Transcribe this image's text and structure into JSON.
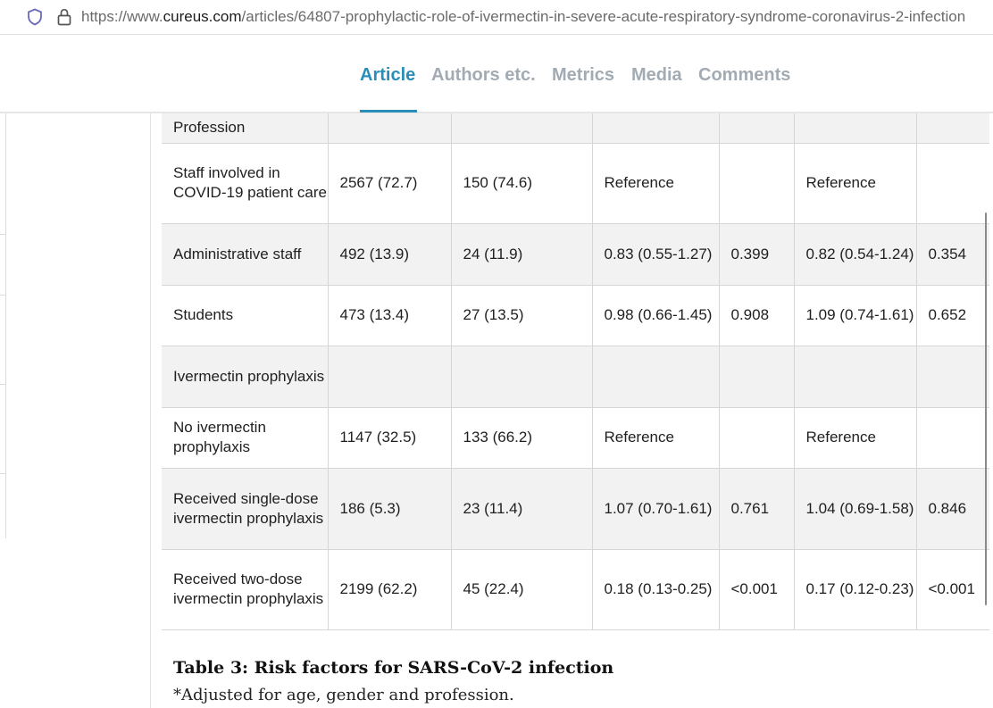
{
  "browser": {
    "url_prefix": "https://www.",
    "url_host": "cureus.com",
    "url_path": "/articles/64807-prophylactic-role-of-ivermectin-in-severe-acute-respiratory-syndrome-coronavirus-2-infection"
  },
  "tabs": [
    {
      "label": "Article",
      "active": true
    },
    {
      "label": "Authors etc.",
      "active": false
    },
    {
      "label": "Metrics",
      "active": false
    },
    {
      "label": "Media",
      "active": false
    },
    {
      "label": "Comments",
      "active": false
    }
  ],
  "table": {
    "rows": [
      [
        "Profession",
        "",
        "",
        "",
        "",
        "",
        ""
      ],
      [
        "Staff involved in COVID-19 patient care",
        "2567 (72.7)",
        "150 (74.6)",
        "Reference",
        "",
        "Reference",
        ""
      ],
      [
        "Administrative staff",
        "492 (13.9)",
        "24 (11.9)",
        "0.83 (0.55-1.27)",
        "0.399",
        "0.82 (0.54-1.24)",
        "0.354"
      ],
      [
        "Students",
        "473 (13.4)",
        "27 (13.5)",
        "0.98 (0.66-1.45)",
        "0.908",
        "1.09 (0.74-1.61)",
        "0.652"
      ],
      [
        "Ivermectin prophylaxis",
        "",
        "",
        "",
        "",
        "",
        ""
      ],
      [
        "No ivermectin prophylaxis",
        "1147 (32.5)",
        "133 (66.2)",
        "Reference",
        "",
        "Reference",
        ""
      ],
      [
        "Received single-dose ivermectin prophylaxis",
        "186 (5.3)",
        "23 (11.4)",
        "1.07 (0.70-1.61)",
        "0.761",
        "1.04 (0.69-1.58)",
        "0.846"
      ],
      [
        "Received two-dose ivermectin prophylaxis",
        "2199 (62.2)",
        "45 (22.4)",
        "0.18 (0.13-0.25)",
        "<0.001",
        "0.17 (0.12-0.23)",
        "<0.001"
      ]
    ]
  },
  "caption": {
    "title": "Table 3: Risk factors for SARS-CoV-2 infection",
    "footnote": "*Adjusted for age, gender and profession."
  }
}
